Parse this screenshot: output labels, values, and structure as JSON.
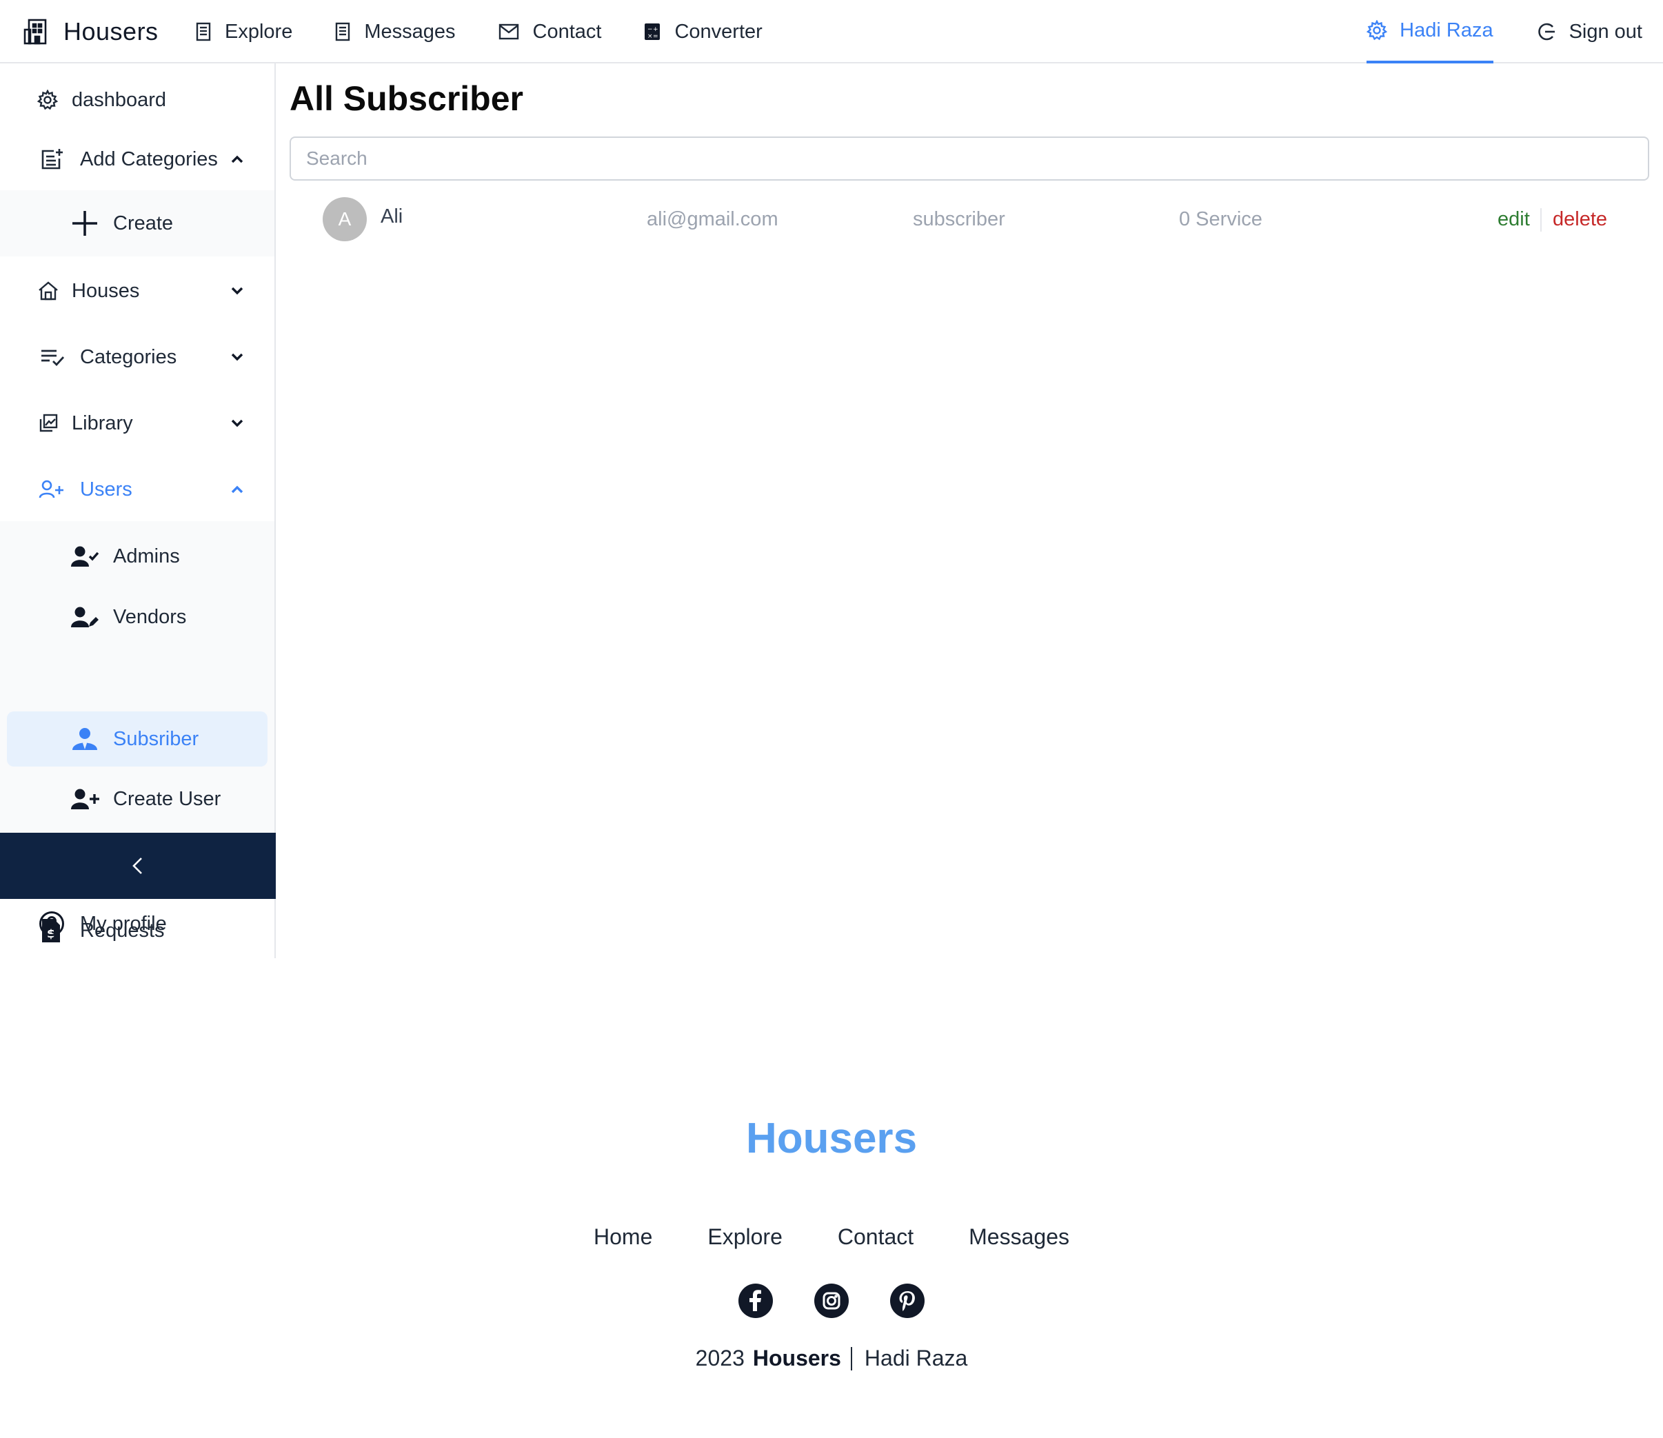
{
  "nav": {
    "brand": "Housers",
    "links": [
      {
        "label": "Explore",
        "icon": "building-icon"
      },
      {
        "label": "Messages",
        "icon": "building-icon"
      },
      {
        "label": "Contact",
        "icon": "mail-icon"
      },
      {
        "label": "Converter",
        "icon": "calculator-icon"
      }
    ],
    "user": "Hadi Raza",
    "signout": "Sign out"
  },
  "sidebar": {
    "dashboard": "dashboard",
    "add_categories": "Add Categories",
    "create": "Create",
    "houses": "Houses",
    "categories": "Categories",
    "library": "Library",
    "users": "Users",
    "admins": "Admins",
    "vendors": "Vendors",
    "subscriber": "Subsriber",
    "create_user": "Create User",
    "requests": "Requests",
    "my_profile": "My profile"
  },
  "main": {
    "title": "All Subscriber",
    "search_placeholder": "Search",
    "rows": [
      {
        "avatar": "A",
        "name": "Ali",
        "email": "ali@gmail.com",
        "role": "subscriber",
        "services": "0 Service",
        "edit": "edit",
        "delete": "delete"
      }
    ]
  },
  "footer": {
    "brand": "Housers",
    "links": [
      "Home",
      "Explore",
      "Contact",
      "Messages"
    ],
    "social": [
      "facebook-icon",
      "instagram-icon",
      "pinterest-icon"
    ],
    "year": "2023",
    "brand_bold": "Housers",
    "author": "Hadi Raza"
  },
  "colors": {
    "accent": "#3b82f6",
    "footer_brand": "#5aa0f0",
    "collapse_bar": "#0f2342",
    "active_bg": "#e7f1fd",
    "edit": "#2e7d32",
    "delete": "#c62828"
  }
}
